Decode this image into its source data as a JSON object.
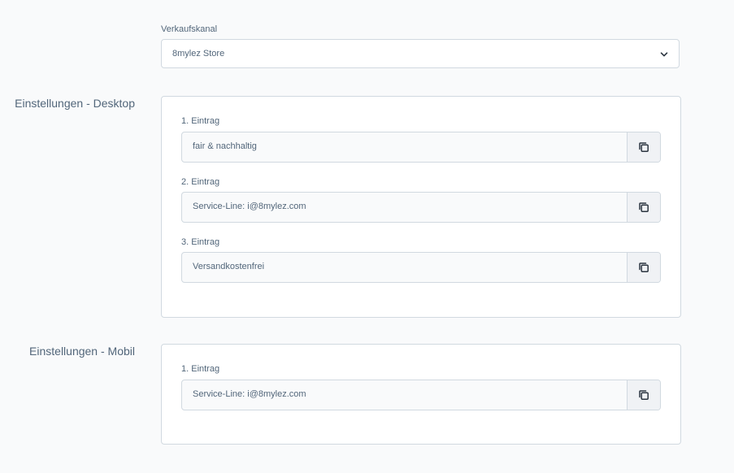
{
  "sales_channel": {
    "label": "Verkaufskanal",
    "value": "8mylez Store",
    "icon": "chevron-down-icon"
  },
  "desktop": {
    "title": "Einstellungen - Desktop",
    "entries": [
      {
        "label": "1. Eintrag",
        "value": "fair & nachhaltig"
      },
      {
        "label": "2. Eintrag",
        "value": "Service-Line: i@8mylez.com"
      },
      {
        "label": "3. Eintrag",
        "value": "Versandkostenfrei"
      }
    ]
  },
  "mobile": {
    "title": "Einstellungen - Mobil",
    "entries": [
      {
        "label": "1. Eintrag",
        "value": "Service-Line: i@8mylez.com"
      }
    ]
  },
  "copy_icon": "copy-icon",
  "colors": {
    "background": "#f9fafb",
    "border": "#d1d9e0",
    "text": "#52667a",
    "button_bg": "#f0f2f5"
  }
}
